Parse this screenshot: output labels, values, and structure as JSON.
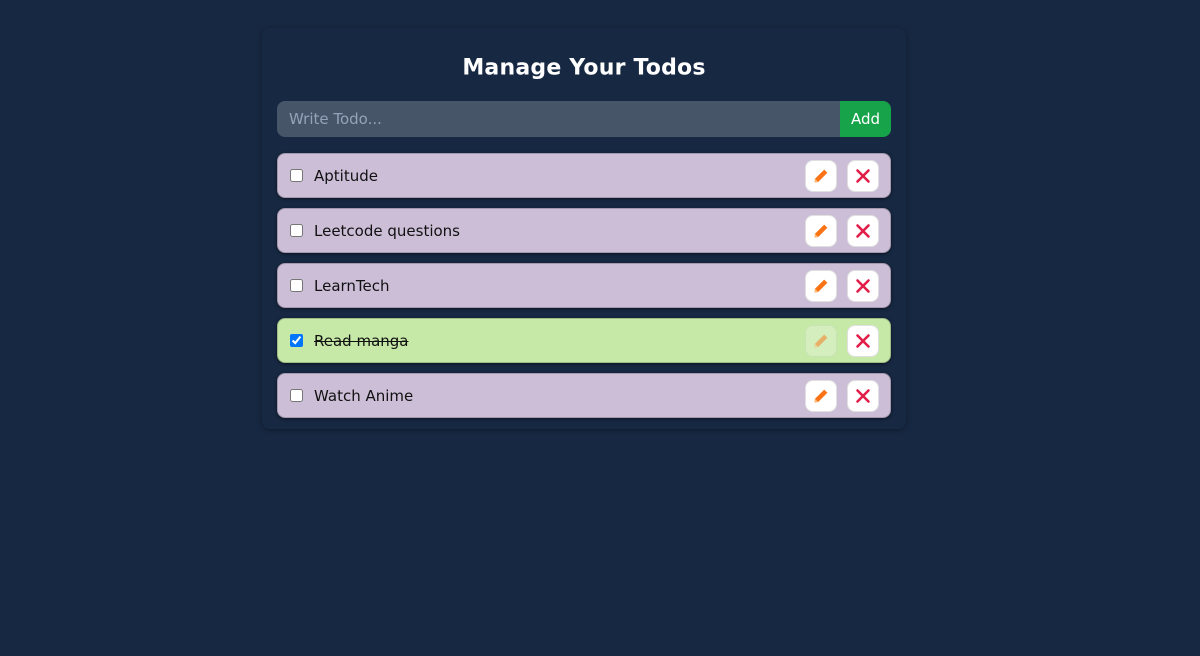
{
  "title": "Manage Your Todos",
  "form": {
    "placeholder": "Write Todo...",
    "value": "",
    "add_label": "Add"
  },
  "todos": [
    {
      "text": "Aptitude",
      "completed": false
    },
    {
      "text": "Leetcode questions",
      "completed": false
    },
    {
      "text": "LearnTech",
      "completed": false
    },
    {
      "text": "Read manga",
      "completed": true
    },
    {
      "text": "Watch Anime",
      "completed": false
    }
  ],
  "colors": {
    "background": "#172842",
    "input_bg": "#475569",
    "add_button": "#16a34a",
    "todo_pending": "#ccbed7",
    "todo_completed": "#c6e9a7",
    "edit_icon": "#f97316",
    "delete_icon": "#e11d48"
  },
  "icons": {
    "edit": "pencil-icon",
    "delete": "close-icon"
  }
}
